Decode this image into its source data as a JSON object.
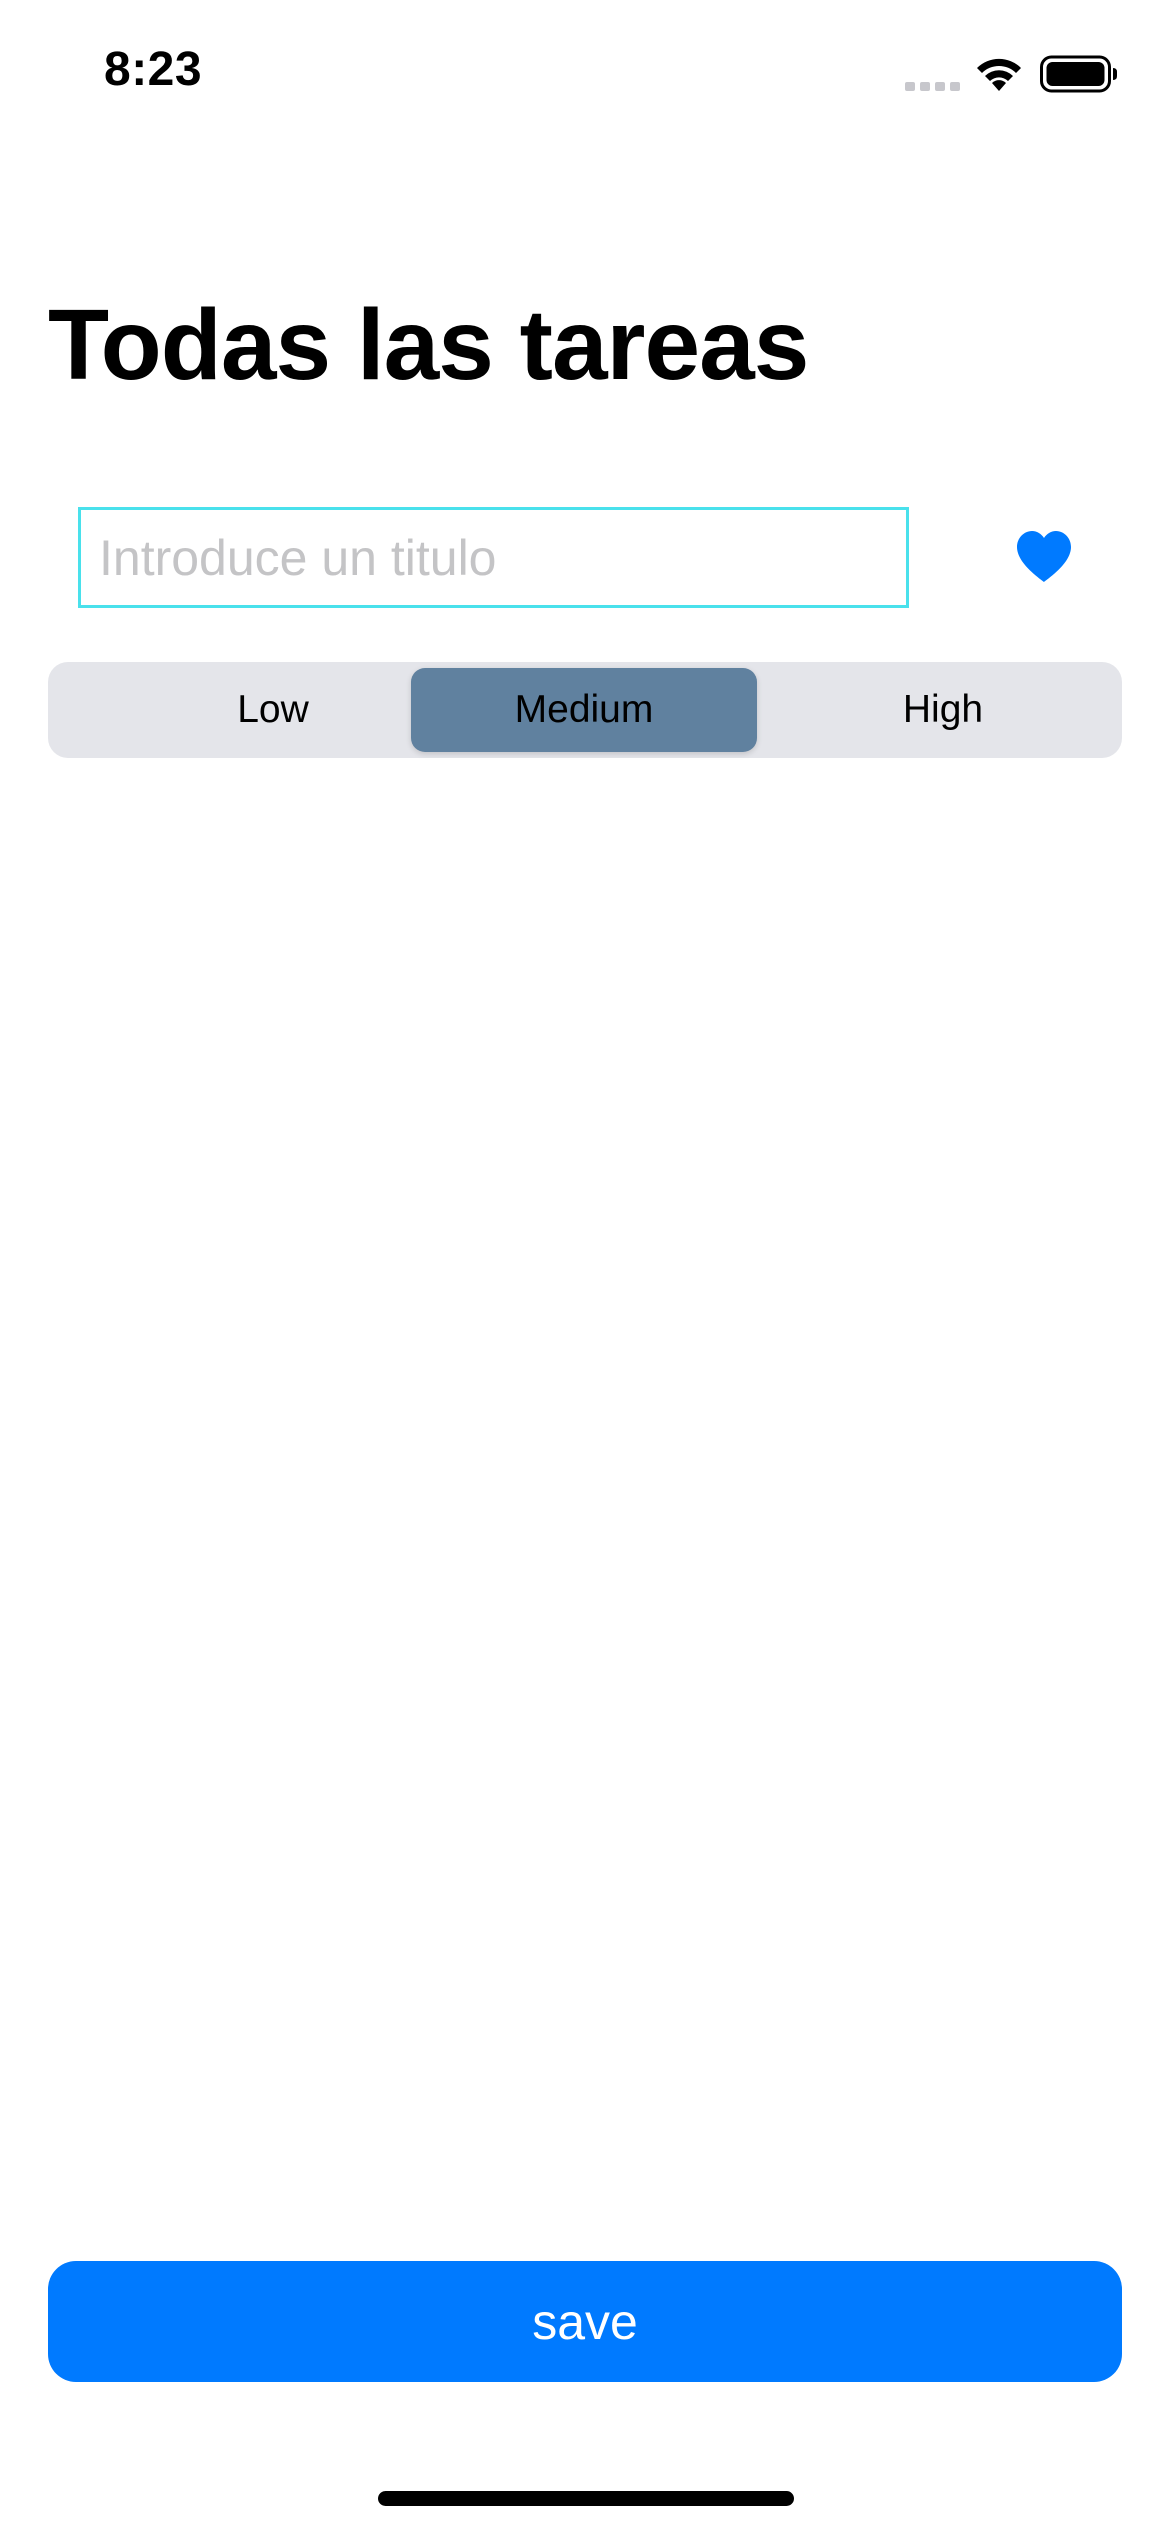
{
  "status_bar": {
    "time": "8:23",
    "icons": [
      "cellular-signal-icon",
      "wifi-icon",
      "battery-icon"
    ]
  },
  "header": {
    "title": "Todas las tareas"
  },
  "form": {
    "title_input": {
      "value": "",
      "placeholder": "Introduce un titulo"
    },
    "favorite_icon": "heart-icon"
  },
  "priority": {
    "options": [
      "Low",
      "Medium",
      "High"
    ],
    "selected": "Medium"
  },
  "actions": {
    "save_label": "save"
  },
  "colors": {
    "accent": "#007aff",
    "input_border": "#49e1ec",
    "segment_selected": "#60819f",
    "segment_background": "#e4e5ea"
  }
}
